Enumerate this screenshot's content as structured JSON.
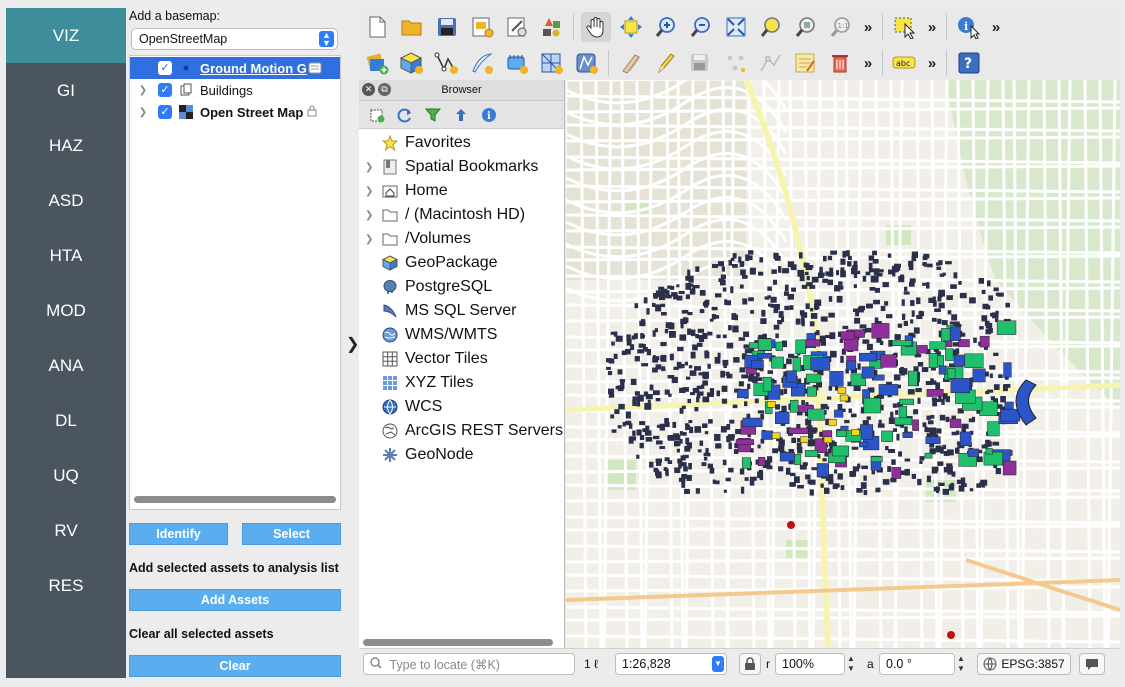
{
  "nav": {
    "items": [
      "VIZ",
      "GI",
      "HAZ",
      "ASD",
      "HTA",
      "MOD",
      "ANA",
      "DL",
      "UQ",
      "RV",
      "RES"
    ],
    "active": "VIZ",
    "active_color": "#3e8d9a",
    "bg_color": "#4a5560"
  },
  "panel": {
    "basemap_label": "Add a basemap:",
    "basemap_value": "OpenStreetMap",
    "layers": [
      {
        "label": "Ground Motion G",
        "checked": true,
        "selected": true,
        "icon": "point-layer-icon"
      },
      {
        "label": "Buildings",
        "checked": true,
        "selected": false,
        "icon": "polygon-layer-icon"
      },
      {
        "label": "Open Street Map",
        "checked": true,
        "selected": false,
        "icon": "raster-layer-icon"
      }
    ],
    "identify_label": "Identify",
    "select_label": "Select",
    "add_selected_label": "Add selected assets to analysis list",
    "add_assets_label": "Add Assets",
    "clear_all_label": "Clear all selected assets",
    "clear_label": "Clear",
    "button_color": "#5aaef0"
  },
  "toolbar1": {
    "icons": [
      "new-project-icon",
      "open-project-icon",
      "save-project-icon",
      "new-print-layout-icon",
      "layout-manager-icon",
      "style-manager-icon",
      "pan-map-icon",
      "pan-to-selection-icon",
      "zoom-in-icon",
      "zoom-out-icon",
      "zoom-full-icon",
      "zoom-to-selection-icon",
      "zoom-to-layer-icon",
      "zoom-native-icon"
    ],
    "more": "»"
  },
  "toolbar2": {
    "icons": [
      "data-source-manager-icon",
      "new-geopackage-layer-icon",
      "digitize-vertex-icon",
      "new-shapefile-icon",
      "new-temporary-layer-icon",
      "new-virtual-layer-icon",
      "new-spatialite-layer-icon",
      "toggle-editing-icon",
      "edit-pencil-icon",
      "save-edits-icon",
      "add-feature-icon",
      "vertex-tool-icon",
      "modify-attributes-icon",
      "delete-selected-icon"
    ],
    "more": "»"
  },
  "browser": {
    "title": "Browser",
    "items": [
      {
        "label": "Favorites",
        "expandable": false,
        "icon": "star-icon"
      },
      {
        "label": "Spatial Bookmarks",
        "expandable": true,
        "icon": "bookmark-icon"
      },
      {
        "label": "Home",
        "expandable": true,
        "icon": "home-icon"
      },
      {
        "label": "/ (Macintosh HD)",
        "expandable": true,
        "icon": "folder-icon"
      },
      {
        "label": "/Volumes",
        "expandable": true,
        "icon": "folder-icon"
      },
      {
        "label": "GeoPackage",
        "expandable": false,
        "icon": "geopackage-icon"
      },
      {
        "label": "PostgreSQL",
        "expandable": false,
        "icon": "postgresql-icon"
      },
      {
        "label": "MS SQL Server",
        "expandable": false,
        "icon": "mssql-icon"
      },
      {
        "label": "WMS/WMTS",
        "expandable": false,
        "icon": "wms-globe-icon"
      },
      {
        "label": "Vector Tiles",
        "expandable": false,
        "icon": "vector-tiles-icon"
      },
      {
        "label": "XYZ Tiles",
        "expandable": false,
        "icon": "xyz-tiles-icon"
      },
      {
        "label": "WCS",
        "expandable": false,
        "icon": "wcs-globe-icon"
      },
      {
        "label": "ArcGIS REST Servers",
        "expandable": false,
        "icon": "arcgis-globe-icon"
      },
      {
        "label": "GeoNode",
        "expandable": false,
        "icon": "geonode-icon"
      }
    ]
  },
  "status": {
    "locate_placeholder": "Type to locate (⌘K)",
    "coord_label": "1 ℓ",
    "scale_value": "1:26,828",
    "rotation_label": "r",
    "magnifier_value": "100%",
    "angle_label": "a",
    "rotation_value": "0.0 °",
    "crs_value": "EPSG:3857"
  },
  "map_colors": {
    "background": "#f2efe9",
    "roads": "#ffffff",
    "major_roads": "#f7f4b0",
    "park": "#cfe8c0",
    "building_dark": "#2a2f4a",
    "building_blue": "#2b55c8",
    "building_green": "#1fbf6b",
    "building_purple": "#8e2f9b",
    "building_yellow": "#f2d51c",
    "hills": "#e5e2d6"
  }
}
